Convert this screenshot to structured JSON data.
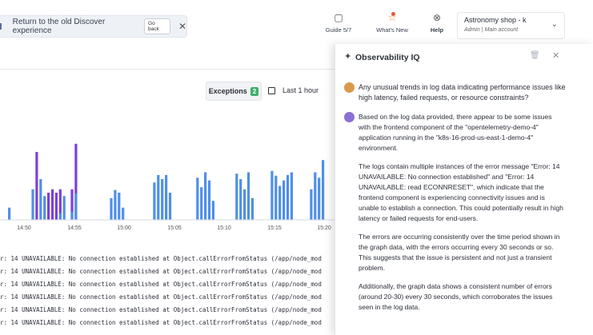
{
  "topbar": {
    "banner": {
      "text": "Return to the old Discover experience",
      "goback": "Go back",
      "close": "✕"
    },
    "guide": {
      "label": "Guide 5/7",
      "icon": "clipboard-icon"
    },
    "whatsnew": {
      "label": "What's New",
      "icon": "star-icon"
    },
    "help": {
      "label": "Help",
      "icon": "help-icon"
    },
    "account": {
      "name": "Astronomy shop - k",
      "role": "Admin",
      "scope": "Main account"
    }
  },
  "controls": {
    "exceptions_label": "Exceptions",
    "exceptions_count": "2",
    "time_range": "Last 1 hour"
  },
  "chart_data": {
    "type": "bar",
    "x_ticks": [
      "14:50",
      "14:55",
      "15:00",
      "15:05",
      "15:10",
      "15:15",
      "15:20"
    ],
    "colors": {
      "exceptions": "#7b3fe0",
      "logs": "#4f8fe8"
    },
    "series": [
      {
        "values_blue": [
          18,
          0,
          0,
          0,
          0,
          0,
          45,
          0,
          60,
          35,
          0,
          0,
          0,
          28,
          35,
          0,
          35,
          120,
          0,
          0,
          0,
          0,
          0,
          0,
          0,
          0,
          32,
          44,
          40,
          18,
          0,
          0,
          0,
          0,
          0,
          0,
          0,
          55,
          66,
          60,
          66,
          40,
          0,
          0,
          0,
          0,
          0,
          0,
          62,
          48,
          70,
          58,
          28,
          0,
          0,
          0,
          0,
          0,
          68,
          60,
          45,
          70,
          32,
          0,
          0,
          0,
          0,
          72,
          65,
          50,
          58,
          66,
          70,
          0,
          0,
          0,
          0,
          45,
          70,
          62,
          88,
          0,
          0,
          0,
          0
        ]
      },
      {
        "values_purple": [
          0,
          0,
          0,
          0,
          0,
          0,
          0,
          100,
          0,
          0,
          40,
          45,
          40,
          45,
          0,
          0,
          45,
          112,
          0,
          0,
          0,
          0,
          0,
          0,
          0,
          0,
          0,
          0,
          0,
          0,
          0,
          0,
          0,
          0,
          0,
          0,
          0,
          0,
          0,
          0,
          0,
          0,
          0,
          0,
          0,
          0,
          0,
          0,
          0,
          0,
          0,
          0,
          0,
          0,
          0,
          0,
          0,
          0,
          0,
          0,
          0,
          0,
          0,
          0,
          0,
          0,
          0,
          0,
          0,
          0,
          0,
          0,
          0,
          0,
          0,
          0,
          0,
          0,
          0,
          0,
          0,
          0,
          0,
          0,
          0
        ]
      }
    ]
  },
  "logs": {
    "lines": [
      "r: 14 UNAVAILABLE: No connection established at Object.callErrorFromStatus (/app/node_mod",
      "r: 14 UNAVAILABLE: No connection established at Object.callErrorFromStatus (/app/node_mod",
      "r: 14 UNAVAILABLE: No connection established at Object.callErrorFromStatus (/app/node_mod",
      "r: 14 UNAVAILABLE: No connection established at Object.callErrorFromStatus (/app/node_mod",
      "r: 14 UNAVAILABLE: No connection established at Object.callErrorFromStatus (/app/node_mod",
      "r: 14 UNAVAILABLE: No connection established at Object.callErrorFromStatus (/app/node_mod"
    ]
  },
  "panel": {
    "title": "Observability IQ",
    "question": "Any unusual trends in log data indicating performance issues like high latency, failed requests, or resource constraints?",
    "answer_intro": "Based on the log data provided, there appear to be some issues with the frontend component of the \"opentelemetry-demo-4\" application running in the \"k8s-16-prod-us-east-1-demo-4\" environment.",
    "paragraphs": [
      "The logs contain multiple instances of the error message \"Error: 14 UNAVAILABLE: No connection established\" and \"Error: 14 UNAVAILABLE: read ECONNRESET\", which indicate that the frontend component is experiencing connectivity issues and is unable to establish a connection. This could potentially result in high latency or failed requests for end-users.",
      "The errors are occurring consistently over the time period shown in the graph data, with the errors occurring every 30 seconds or so. This suggests that the issue is persistent and not just a transient problem.",
      "Additionally, the graph data shows a consistent number of errors (around 20-30) every 30 seconds, which corroborates the issues seen in the log data."
    ]
  }
}
